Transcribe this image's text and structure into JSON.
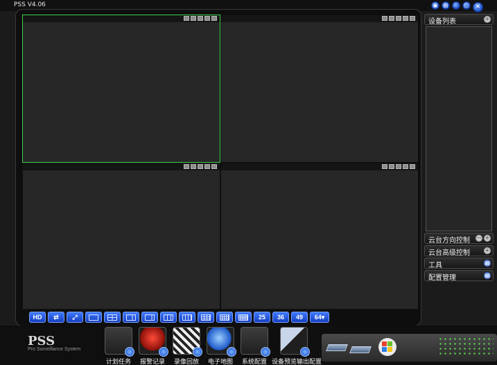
{
  "window": {
    "title": "PSS  V4.06",
    "close_glyph": "✕"
  },
  "panes": [
    {
      "name": "video-pane-1",
      "active": true
    },
    {
      "name": "video-pane-2",
      "active": false
    },
    {
      "name": "video-pane-3",
      "active": false
    },
    {
      "name": "video-pane-4",
      "active": false
    }
  ],
  "toolbar": {
    "hd": "HD",
    "split_labels": [
      "25",
      "36",
      "49",
      "64▾"
    ]
  },
  "right_panel": {
    "device_list": "设备列表",
    "ptz_direction": "云台方向控制",
    "ptz_advanced": "云台高级控制",
    "tools": "工具",
    "config_mgmt": "配置管理"
  },
  "brand": {
    "name": "PSS",
    "subtitle": "Pro Surveillance System"
  },
  "bottom_tiles": [
    {
      "label": "计划任务",
      "icon": "camera-schedule-icon"
    },
    {
      "label": "报警记录",
      "icon": "alarm-siren-icon"
    },
    {
      "label": "录像回放",
      "icon": "clapperboard-icon"
    },
    {
      "label": "电子地图",
      "icon": "globe-map-icon"
    },
    {
      "label": "系统配置",
      "icon": "system-settings-icon"
    },
    {
      "label": "设备预览输出配置",
      "icon": "preview-output-config-icon"
    }
  ],
  "colors": {
    "accent": "#2a5be0",
    "active_pane": "#3cd24a",
    "panel_bg": "#262626"
  }
}
